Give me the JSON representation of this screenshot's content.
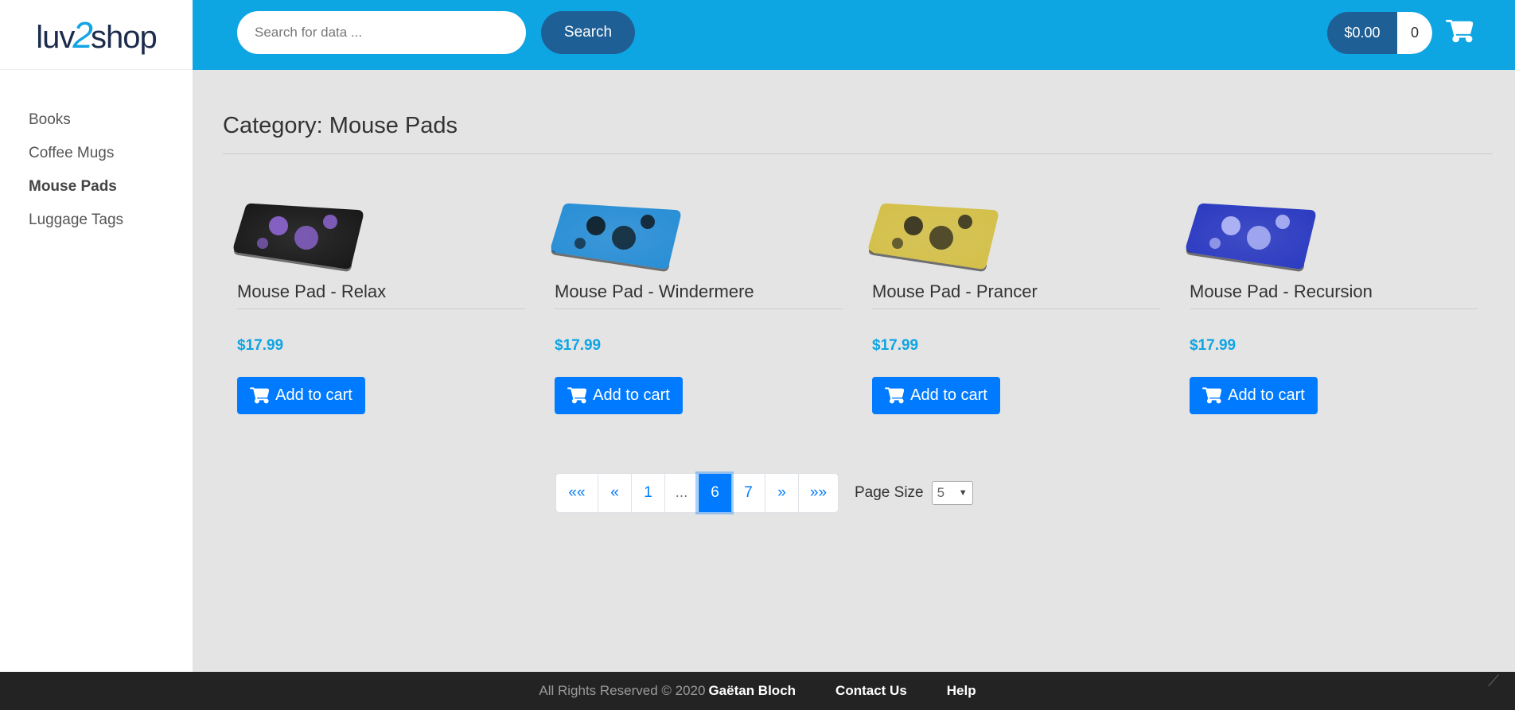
{
  "brand": {
    "logo_left": "luv",
    "logo_two": "2",
    "logo_right": "shop"
  },
  "sidebar": {
    "categories": [
      {
        "label": "Books",
        "active": false
      },
      {
        "label": "Coffee Mugs",
        "active": false
      },
      {
        "label": "Mouse Pads",
        "active": true
      },
      {
        "label": "Luggage Tags",
        "active": false
      }
    ]
  },
  "header": {
    "search_placeholder": "Search for data ...",
    "search_button": "Search",
    "cart_total": "$0.00",
    "cart_quantity": "0"
  },
  "main": {
    "title": "Category: Mouse Pads",
    "products": [
      {
        "name": "Mouse Pad - Relax",
        "price": "$17.99",
        "button": "Add to cart",
        "pad_color": "#1a1a1a",
        "accent": "#9b6ee8"
      },
      {
        "name": "Mouse Pad - Windermere",
        "price": "$17.99",
        "button": "Add to cart",
        "pad_color": "#2a8fd6",
        "accent": "#0b0b0b"
      },
      {
        "name": "Mouse Pad - Prancer",
        "price": "$17.99",
        "button": "Add to cart",
        "pad_color": "#d4c04a",
        "accent": "#1a1a1a"
      },
      {
        "name": "Mouse Pad - Recursion",
        "price": "$17.99",
        "button": "Add to cart",
        "pad_color": "#2d3cc2",
        "accent": "#c8ccff"
      }
    ]
  },
  "pagination": {
    "items": [
      {
        "label": "««",
        "name": "page-first"
      },
      {
        "label": "«",
        "name": "page-prev"
      },
      {
        "label": "1",
        "name": "page-1"
      },
      {
        "label": "...",
        "name": "page-ellipsis"
      },
      {
        "label": "6",
        "name": "page-6",
        "active": true
      },
      {
        "label": "7",
        "name": "page-7"
      },
      {
        "label": "»",
        "name": "page-next"
      },
      {
        "label": "»»",
        "name": "page-last"
      }
    ],
    "page_size_label": "Page Size",
    "page_size_value": "5"
  },
  "footer": {
    "copyright": "All Rights Reserved © 2020",
    "author": "Gaëtan Bloch",
    "contact": "Contact Us",
    "help": "Help"
  },
  "colors": {
    "header_bg": "#0ea5e3",
    "primary": "#007bff",
    "dark_blue": "#1e5f95"
  }
}
